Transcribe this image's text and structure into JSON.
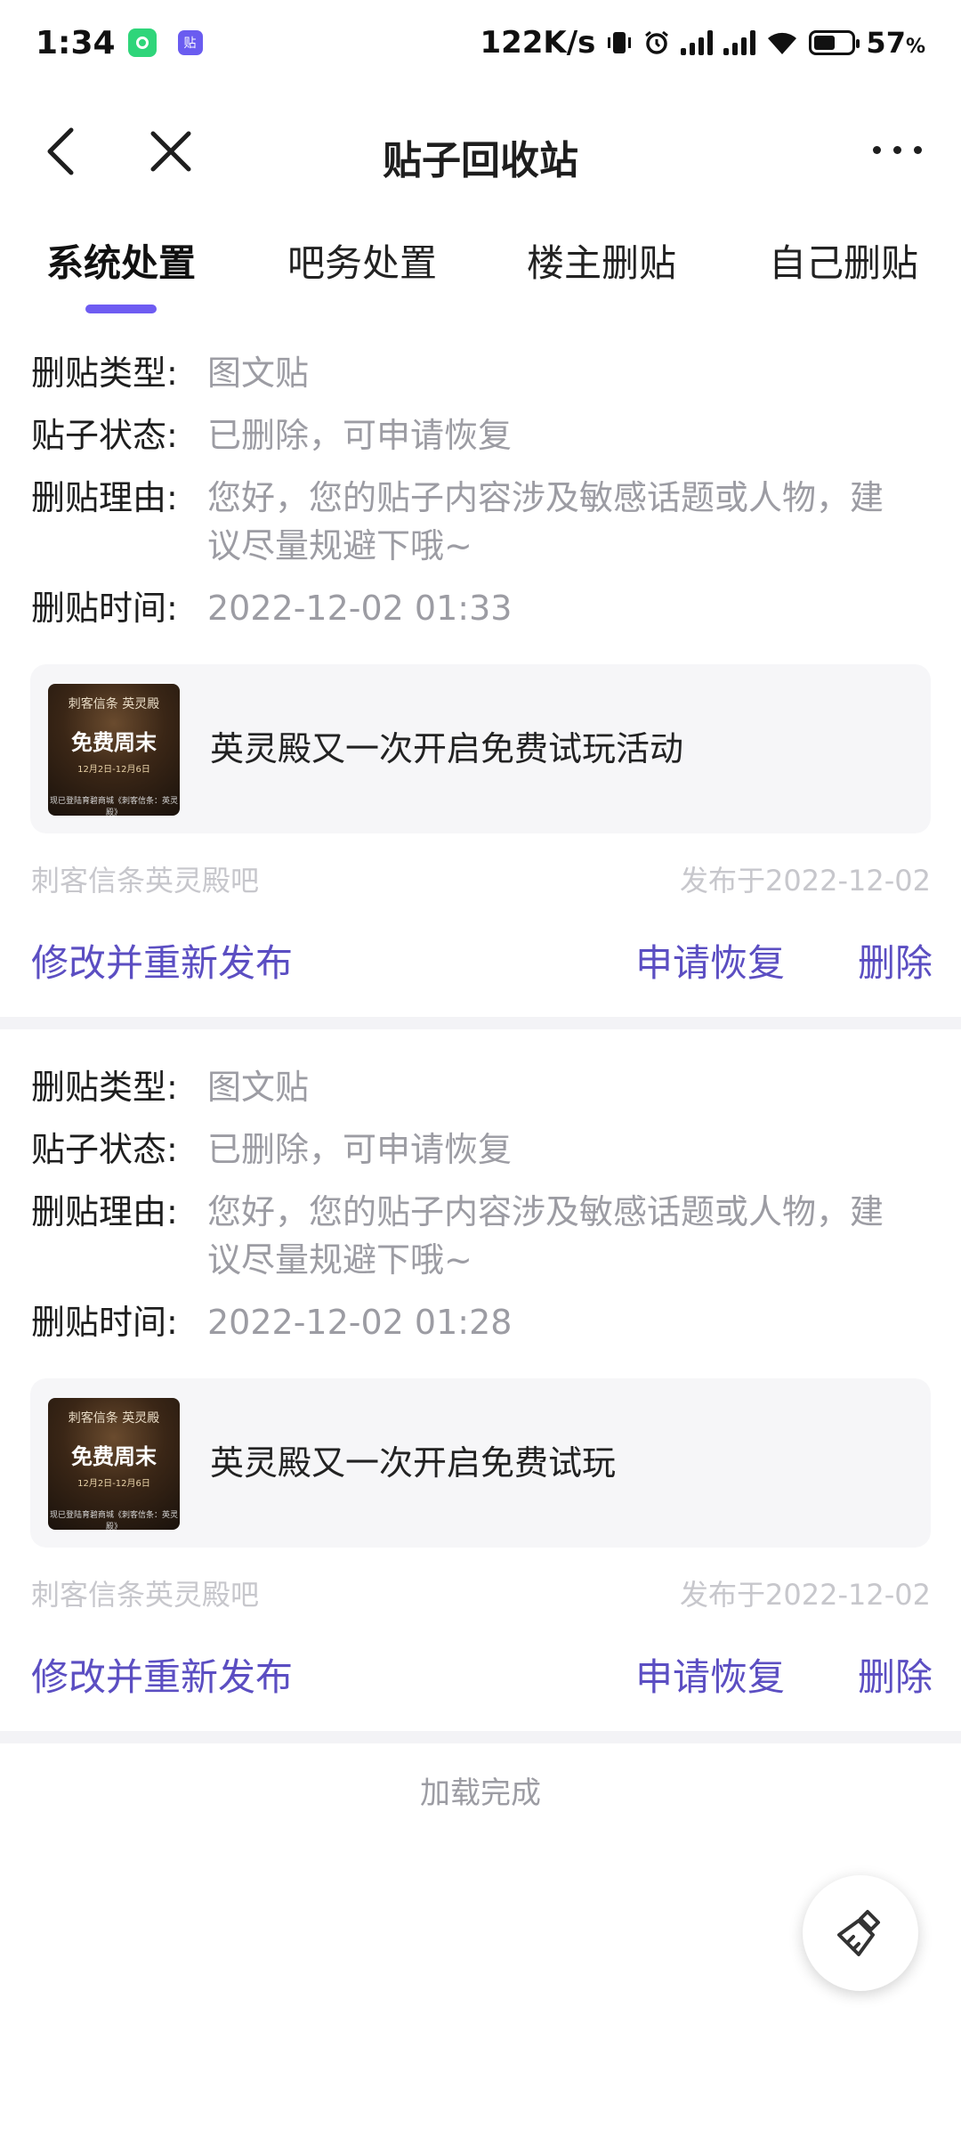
{
  "status_bar": {
    "time": "1:34",
    "app_icon_2_text": "贴",
    "net_speed": "122K/s",
    "battery_pct": "57",
    "battery_unit": "%",
    "battery_level": 0.57
  },
  "nav": {
    "title": "贴子回收站"
  },
  "tabs": [
    {
      "label": "系统处置",
      "active": true
    },
    {
      "label": "吧务处置",
      "active": false
    },
    {
      "label": "楼主删贴",
      "active": false
    },
    {
      "label": "自己删贴",
      "active": false
    }
  ],
  "labels": {
    "type": "删贴类型:",
    "status": "贴子状态:",
    "reason": "删贴理由:",
    "time": "删贴时间:"
  },
  "posts": [
    {
      "type": "图文贴",
      "status": "已删除，可申请恢复",
      "reason_line1": "您好，您的贴子内容涉及敏感话题或人物，建",
      "reason_line2": "议尽量规避下哦~",
      "time": "2022-12-02 01:33",
      "thumb_top": "刺客信条 英灵殿",
      "thumb_main": "免费周末",
      "thumb_date": "12月2日-12月6日",
      "thumb_bottom": "现已登陆育碧商城《刺客信条：英灵殿》",
      "title": "英灵殿又一次开启免费试玩活动",
      "forum": "刺客信条英灵殿吧",
      "pubdate": "发布于2022-12-02",
      "action_republish": "修改并重新发布",
      "action_restore": "申请恢复",
      "action_delete": "删除"
    },
    {
      "type": "图文贴",
      "status": "已删除，可申请恢复",
      "reason_line1": "您好，您的贴子内容涉及敏感话题或人物，建",
      "reason_line2": "议尽量规避下哦~",
      "time": "2022-12-02 01:28",
      "thumb_top": "刺客信条 英灵殿",
      "thumb_main": "免费周末",
      "thumb_date": "12月2日-12月6日",
      "thumb_bottom": "现已登陆育碧商城《刺客信条：英灵殿》",
      "title": "英灵殿又一次开启免费试玩",
      "forum": "刺客信条英灵殿吧",
      "pubdate": "发布于2022-12-02",
      "action_republish": "修改并重新发布",
      "action_restore": "申请恢复",
      "action_delete": "删除"
    }
  ],
  "footer": {
    "load_done": "加载完成"
  },
  "colors": {
    "accent": "#6e5cf2",
    "action": "#5b4ec2",
    "muted": "#9c9ca3",
    "faint": "#c7c7cc"
  },
  "icons": {
    "back": "chevron-left-icon",
    "close": "close-icon",
    "more": "more-icon",
    "fab": "broom-icon"
  }
}
